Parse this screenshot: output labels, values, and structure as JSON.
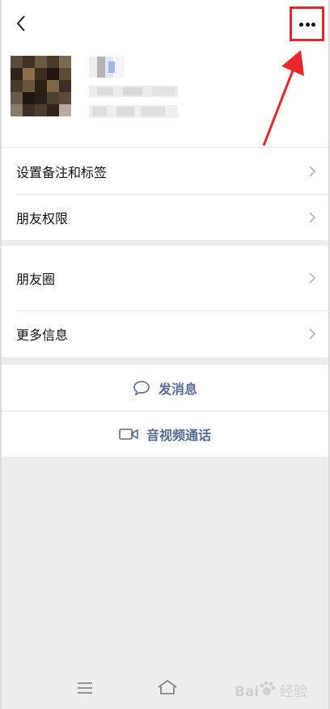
{
  "header": {
    "back_icon": "chevron-left-icon",
    "more_icon": "more-dots-icon",
    "highlight_color": "#e8262a"
  },
  "profile": {
    "avatar": "blurred-avatar",
    "name_blurred": true,
    "details_blurred": true
  },
  "settings_group": {
    "items": [
      {
        "label": "设置备注和标签"
      },
      {
        "label": "朋友权限"
      }
    ]
  },
  "info_group": {
    "items": [
      {
        "label": "朋友圈"
      },
      {
        "label": "更多信息"
      }
    ]
  },
  "actions": {
    "message_label": "发消息",
    "message_icon": "chat-bubble-icon",
    "call_label": "音视频通话",
    "call_icon": "video-camera-icon",
    "color": "#576b95"
  },
  "system_nav": {
    "menu_icon": "menu-icon",
    "home_icon": "home-icon"
  },
  "watermark": {
    "text": "Bai 经验"
  }
}
